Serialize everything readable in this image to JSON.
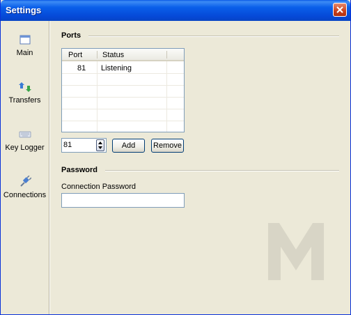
{
  "window": {
    "title": "Settings"
  },
  "sidebar": {
    "items": [
      {
        "label": "Main",
        "icon": "window-icon"
      },
      {
        "label": "Transfers",
        "icon": "transfer-arrows-icon"
      },
      {
        "label": "Key Logger",
        "icon": "keyboard-icon"
      },
      {
        "label": "Connections",
        "icon": "plug-icon"
      }
    ]
  },
  "ports": {
    "section_title": "Ports",
    "columns": [
      "Port",
      "Status"
    ],
    "rows": [
      {
        "port": "81",
        "status": "Listening"
      }
    ],
    "spin_value": "81",
    "add_label": "Add",
    "remove_label": "Remove"
  },
  "password": {
    "section_title": "Password",
    "field_label": "Connection Password",
    "value": ""
  },
  "colors": {
    "titlebar": "#0a5fea",
    "background": "#ece9d8",
    "close_button": "#c9401b"
  }
}
